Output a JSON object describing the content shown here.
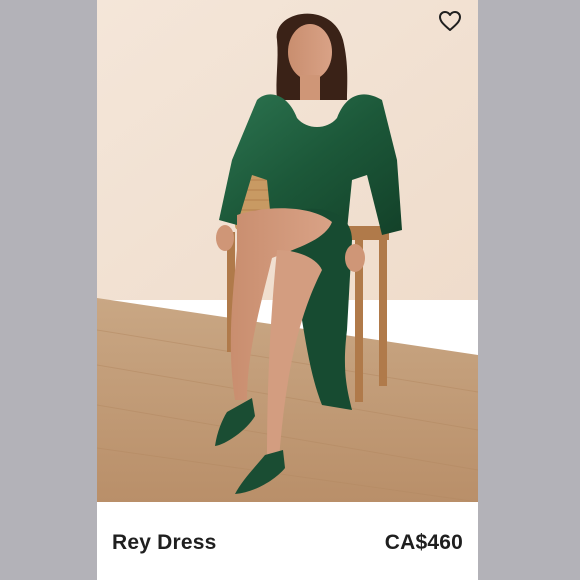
{
  "listing": {
    "title": "Rey Dress",
    "price": "CA$460",
    "like_icon": "heart-outline-icon",
    "photo_subject": "model in green satin dress on wooden chair"
  },
  "colors": {
    "page_bg": "#b3b2b8",
    "card_bg": "#ffffff",
    "dress": "#1f5a3c",
    "text": "#1f1f1f"
  }
}
